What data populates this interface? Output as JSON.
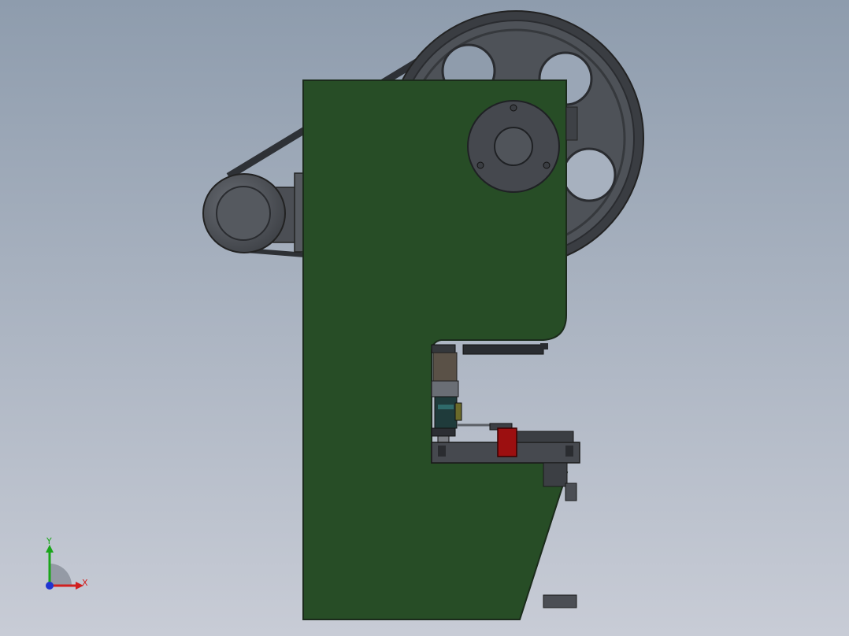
{
  "view": {
    "background_top": "#8e9cad",
    "background_bottom": "#c8ccd6"
  },
  "model": {
    "frame_color": "#274d26",
    "frame_edge": "#1b2b1b",
    "flywheel_color": "#4e5258",
    "flywheel_dark": "#3a3d42",
    "hole_color": "#eef1f6",
    "motor_color": "#5b5f66",
    "die_block_color": "#9c0f10",
    "bolster_color": "#46494f"
  },
  "triad": {
    "x_label": "X",
    "y_label": "Y",
    "x_color": "#d11f1f",
    "y_color": "#1aa51a",
    "z_color": "#1f35d1"
  }
}
